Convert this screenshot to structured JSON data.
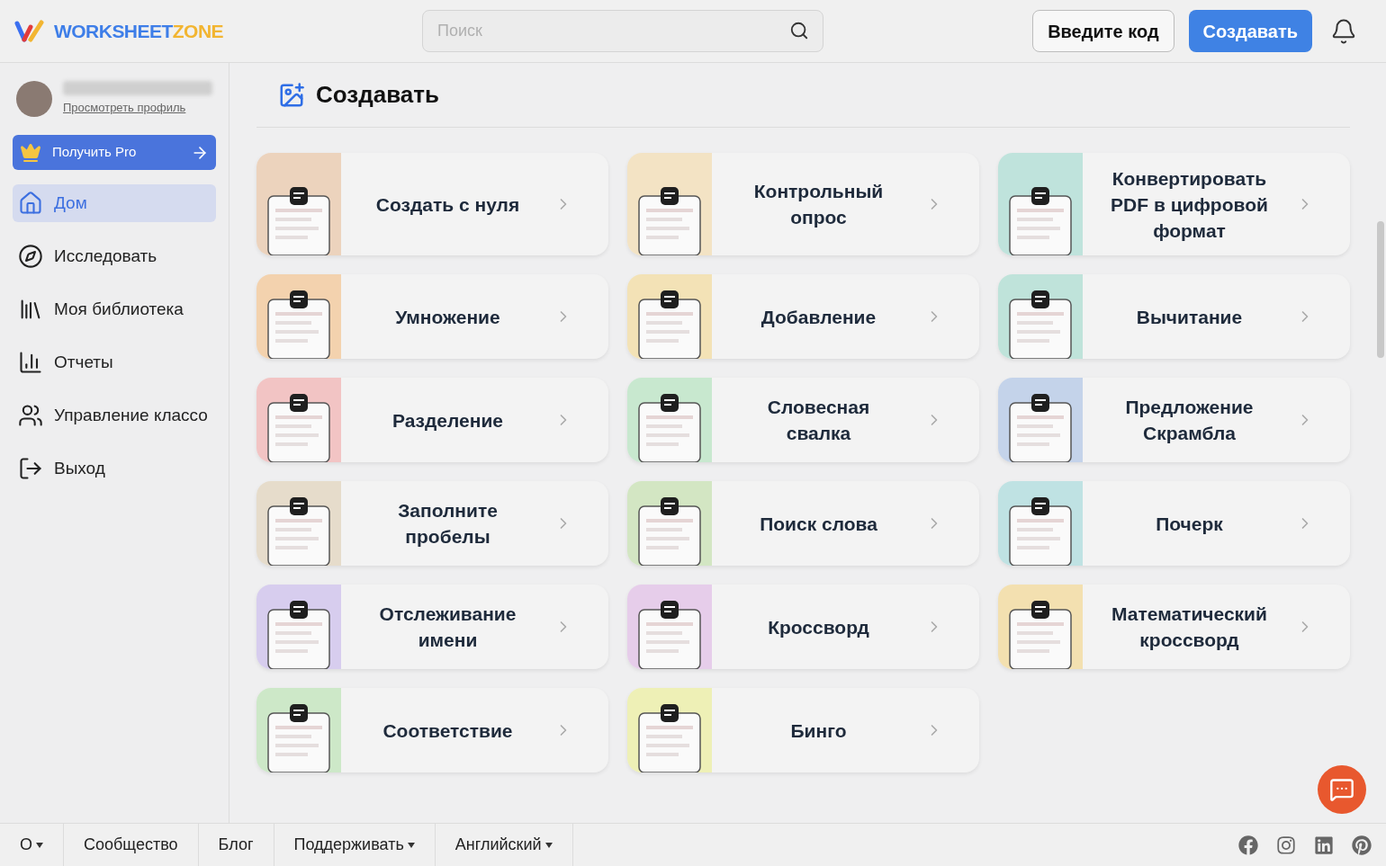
{
  "header": {
    "logo": {
      "part_1": "WORKSHEET",
      "part_2": "ZONE"
    },
    "search": {
      "placeholder": "Поиск"
    },
    "code_button": "Введите код",
    "create_button": "Создавать"
  },
  "sidebar": {
    "profile": {
      "link": "Просмотреть профиль"
    },
    "pro_button": "Получить Pro",
    "items": [
      {
        "label": "Дом",
        "selected": true
      },
      {
        "label": "Исследовать",
        "selected": false
      },
      {
        "label": "Моя библиотека",
        "selected": false
      },
      {
        "label": "Отчеты",
        "selected": false
      },
      {
        "label": "Управление классо",
        "selected": false
      },
      {
        "label": "Выход",
        "selected": false
      }
    ]
  },
  "main": {
    "title": "Создавать",
    "cards": [
      {
        "label": "Создать с нуля",
        "color": "#ecd3bd"
      },
      {
        "label": "Контрольный опрос",
        "color": "#f3e3c4"
      },
      {
        "label": "Конвертировать PDF в цифровой формат",
        "color": "#bfe3dc"
      },
      {
        "label": "Умножение",
        "color": "#f3d2ae"
      },
      {
        "label": "Добавление",
        "color": "#f3e2b6"
      },
      {
        "label": "Вычитание",
        "color": "#bfe3da"
      },
      {
        "label": "Разделение",
        "color": "#f2c4c4"
      },
      {
        "label": "Словесная свалка",
        "color": "#c8e8cf"
      },
      {
        "label": "Предложение Скрамбла",
        "color": "#c4d3ea"
      },
      {
        "label": "Заполните пробелы",
        "color": "#e6dccb"
      },
      {
        "label": "Поиск слова",
        "color": "#d3e6c3"
      },
      {
        "label": "Почерк",
        "color": "#bfe2e3"
      },
      {
        "label": "Отслеживание имени",
        "color": "#d7cdee"
      },
      {
        "label": "Кроссворд",
        "color": "#e6cdea"
      },
      {
        "label": "Математический кроссворд",
        "color": "#f3e0b0"
      },
      {
        "label": "Соответствие",
        "color": "#cde8c8"
      },
      {
        "label": "Бинго",
        "color": "#eef0b6"
      }
    ]
  },
  "footer": {
    "links": [
      {
        "label": "О",
        "has_menu": true
      },
      {
        "label": "Сообщество",
        "has_menu": false
      },
      {
        "label": "Блог",
        "has_menu": false
      },
      {
        "label": "Поддерживать",
        "has_menu": true
      },
      {
        "label": "Английский",
        "has_menu": true
      }
    ]
  }
}
